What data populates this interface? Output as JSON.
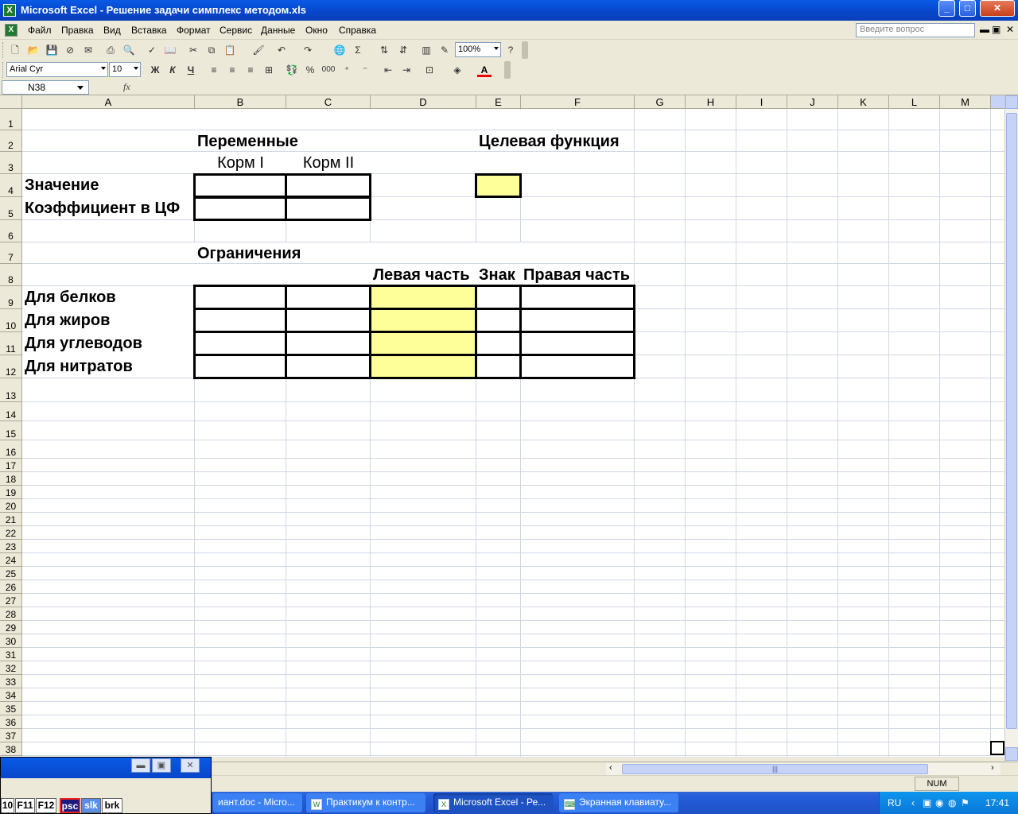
{
  "window": {
    "title": "Microsoft Excel - Решение задачи симплекс методом.xls",
    "min_label": "_",
    "max_label": "□",
    "close_label": "✕"
  },
  "menu": {
    "items": [
      "Файл",
      "Правка",
      "Вид",
      "Вставка",
      "Формат",
      "Сервис",
      "Данные",
      "Окно",
      "Справка"
    ],
    "ask_placeholder": "Введите вопрос",
    "doc_min": "▬",
    "doc_restore": "▣",
    "doc_close": "✕"
  },
  "toolbar": {
    "zoom": "100%",
    "font_name": "Arial Cyr",
    "font_size": "10",
    "bold": "Ж",
    "italic": "К",
    "underline": "Ч",
    "sigma": "Σ",
    "percent": "%",
    "thousands": "000"
  },
  "formula_bar": {
    "name_box": "N38",
    "fx": "fx"
  },
  "columns": [
    "A",
    "B",
    "C",
    "D",
    "E",
    "F",
    "G",
    "H",
    "I",
    "J",
    "K",
    "L",
    "M"
  ],
  "rows": [
    "1",
    "2",
    "3",
    "4",
    "5",
    "6",
    "7",
    "8",
    "9",
    "10",
    "11",
    "12",
    "13",
    "14",
    "15",
    "16",
    "17",
    "18",
    "19",
    "20",
    "21",
    "22",
    "23",
    "24",
    "25",
    "26",
    "27",
    "28",
    "29",
    "30",
    "31",
    "32",
    "33",
    "34",
    "35",
    "36",
    "37",
    "38"
  ],
  "cells": {
    "B2": "Переменные",
    "E2": "Целевая функция",
    "B3": "Корм I",
    "C3": "Корм II",
    "A4": "Значение",
    "A5": "Коэффициент в ЦФ",
    "B7": "Ограничения",
    "D8": "Левая часть",
    "E8": "Знак",
    "F8": "Правая часть",
    "A9": "Для белков",
    "A10": "Для жиров",
    "A11": "Для углеводов",
    "A12": "Для нитратов"
  },
  "colors": {
    "highlight": "#ffff99",
    "titlebar": "#0a5ae6",
    "gridline": "#d0d7e5"
  },
  "status": {
    "num": "NUM"
  },
  "onscreen_keyboard": {
    "keys": [
      "10",
      "F11",
      "F12",
      "psc",
      "slk",
      "brk"
    ]
  },
  "taskbar": {
    "tasks": [
      {
        "label": "иант.doc - Micro...",
        "icon": "word-icon"
      },
      {
        "label": "Практикум к контр...",
        "icon": "word-icon"
      },
      {
        "label": "Microsoft Excel - Ре...",
        "icon": "excel-icon"
      },
      {
        "label": "Экранная клавиату...",
        "icon": "keyboard-icon"
      }
    ],
    "lang": "RU",
    "time": "17:41"
  }
}
